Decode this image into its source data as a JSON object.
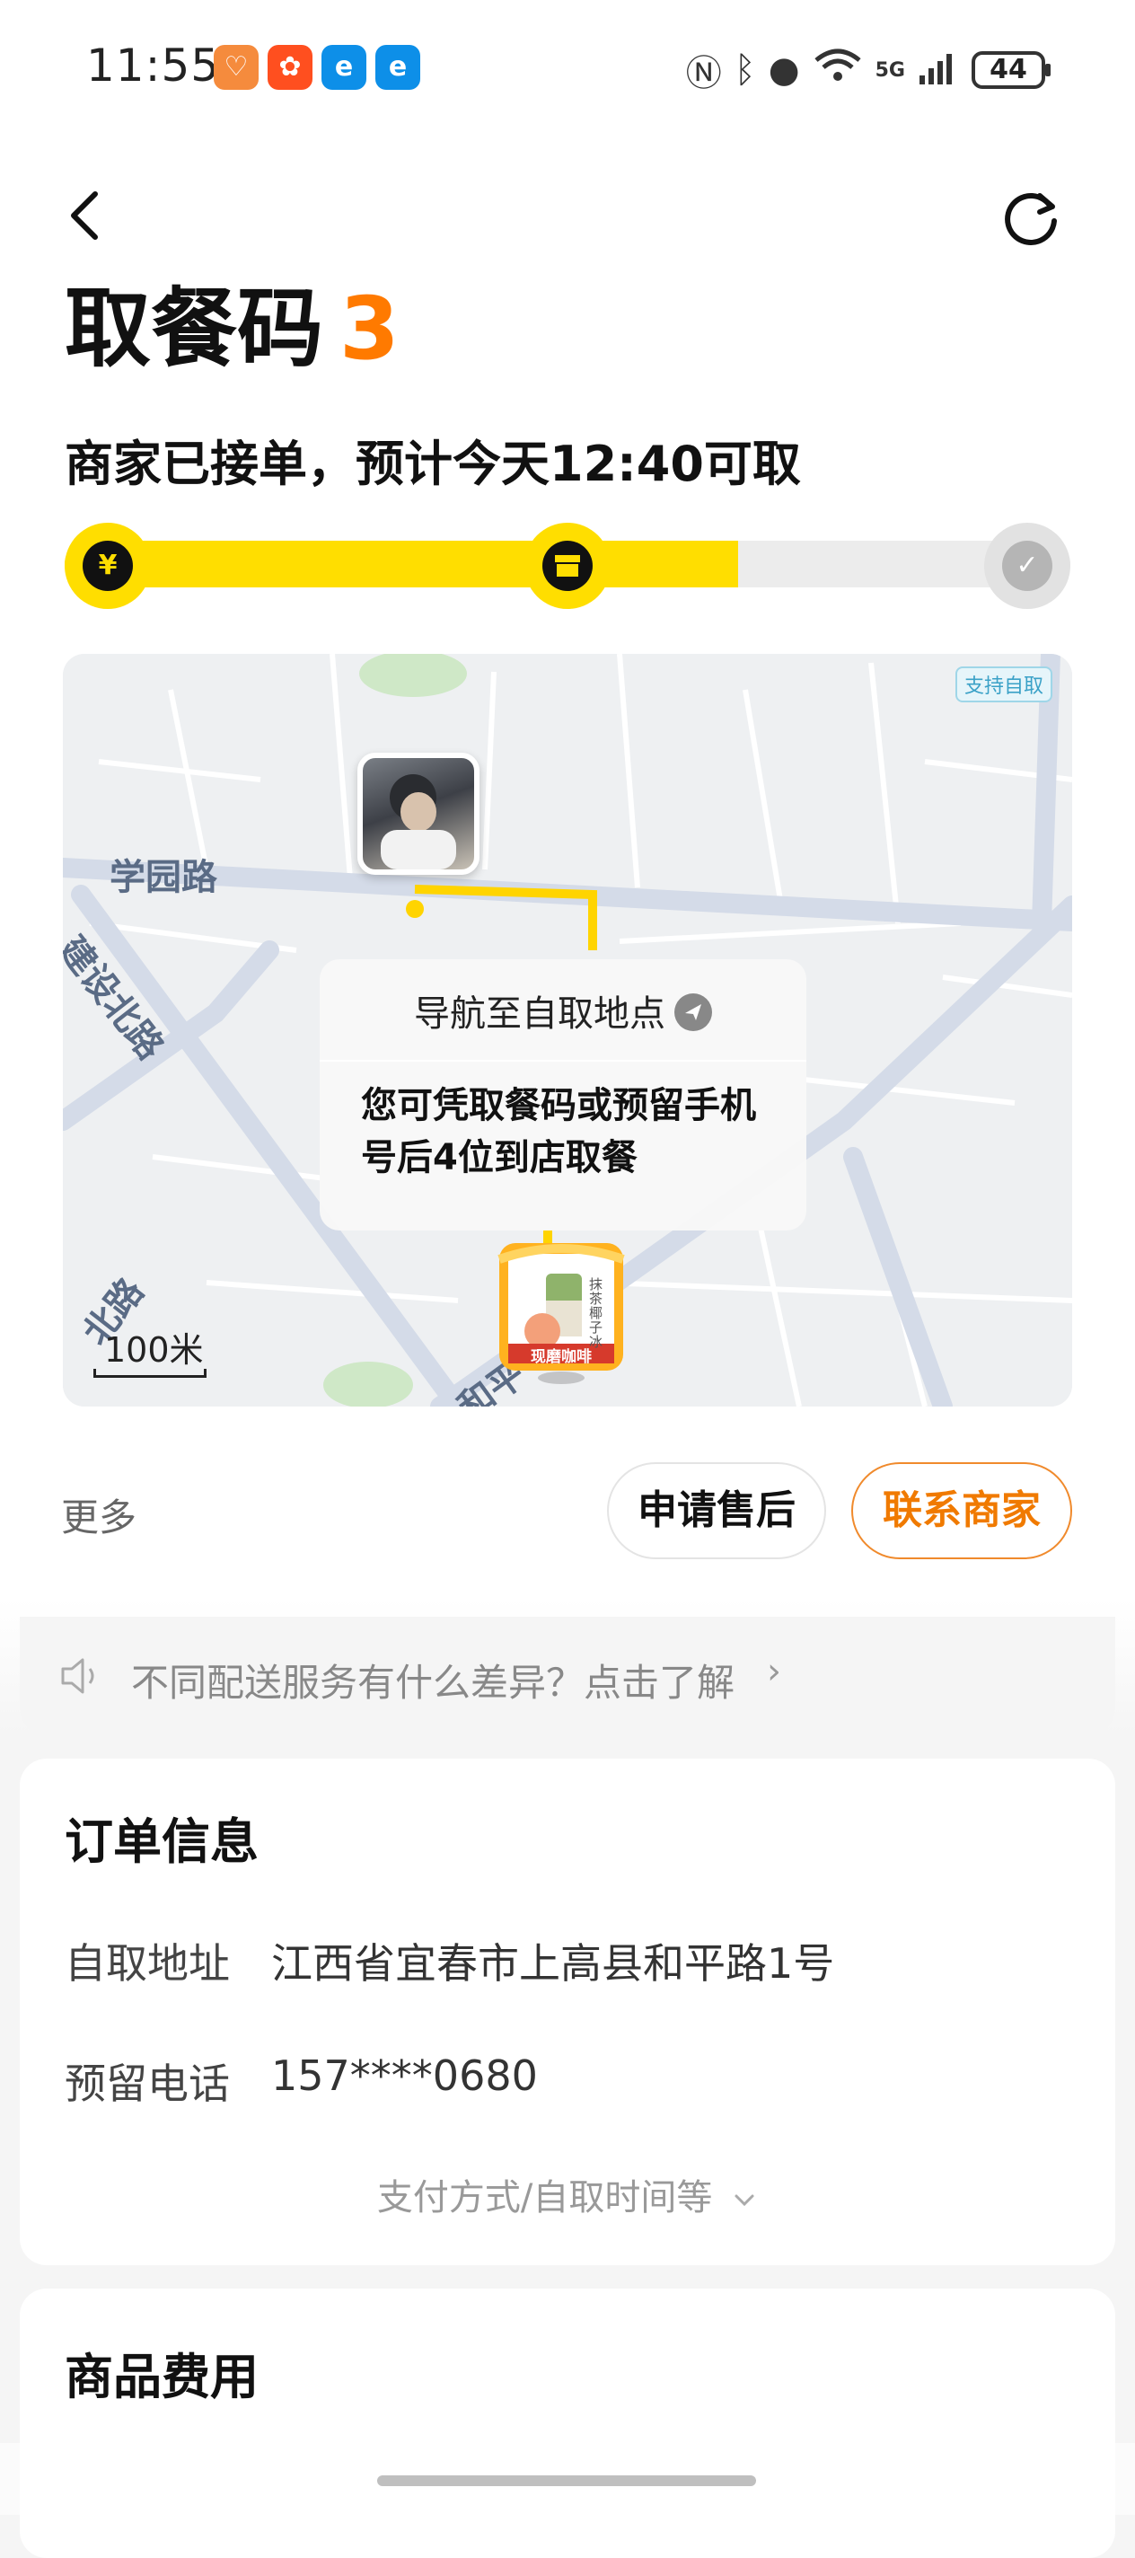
{
  "status_bar": {
    "time": "11:55",
    "network": "5G",
    "battery": "44",
    "app_icons": [
      {
        "name": "taobao-icon",
        "color": "#f58b3d",
        "glyph": "♡"
      },
      {
        "name": "kuaishou-icon",
        "color": "#ff4f1f",
        "glyph": "✿"
      },
      {
        "name": "eleme-icon",
        "color": "#0d8fe8",
        "glyph": "e"
      },
      {
        "name": "eleme-icon-2",
        "color": "#0d8fe8",
        "glyph": "e"
      }
    ]
  },
  "header": {
    "title": "取餐码",
    "pickup_code": "3",
    "subtitle": "商家已接单，预计今天12:40可取"
  },
  "progress": {
    "fraction": 0.67,
    "steps": [
      {
        "icon": "yen-icon",
        "glyph": "¥",
        "state": "done"
      },
      {
        "icon": "store-icon",
        "glyph": "▀",
        "state": "current"
      },
      {
        "icon": "check-icon",
        "glyph": "✓",
        "state": "pending"
      }
    ],
    "colors": {
      "active": "#ffde00",
      "inactive": "#ececec"
    }
  },
  "map": {
    "roads": [
      "学园路",
      "建设北路",
      "北路",
      "和平"
    ],
    "self_pickup_tag": "支持自取",
    "nav_label": "导航至自取地点",
    "tip": "您可凭取餐码或预留手机号后4位到店取餐",
    "store_name": "现磨咖啡",
    "product_label": "抹茶椰子冰",
    "scale": "100米"
  },
  "actions": {
    "more": "更多",
    "after_sale": "申请售后",
    "contact_merchant": "联系商家"
  },
  "banner": {
    "text": "不同配送服务有什么差异？点击了解",
    "chevron": "›"
  },
  "order_info": {
    "title": "订单信息",
    "address_label": "自取地址",
    "address": "江西省宜春市上高县和平路1号",
    "phone_label": "预留电话",
    "phone": "157****0680",
    "expand": "支付方式/自取时间等"
  },
  "fees": {
    "title": "商品费用"
  },
  "theme": {
    "accent_orange": "#ff7a00",
    "brand_yellow": "#ffde00"
  }
}
